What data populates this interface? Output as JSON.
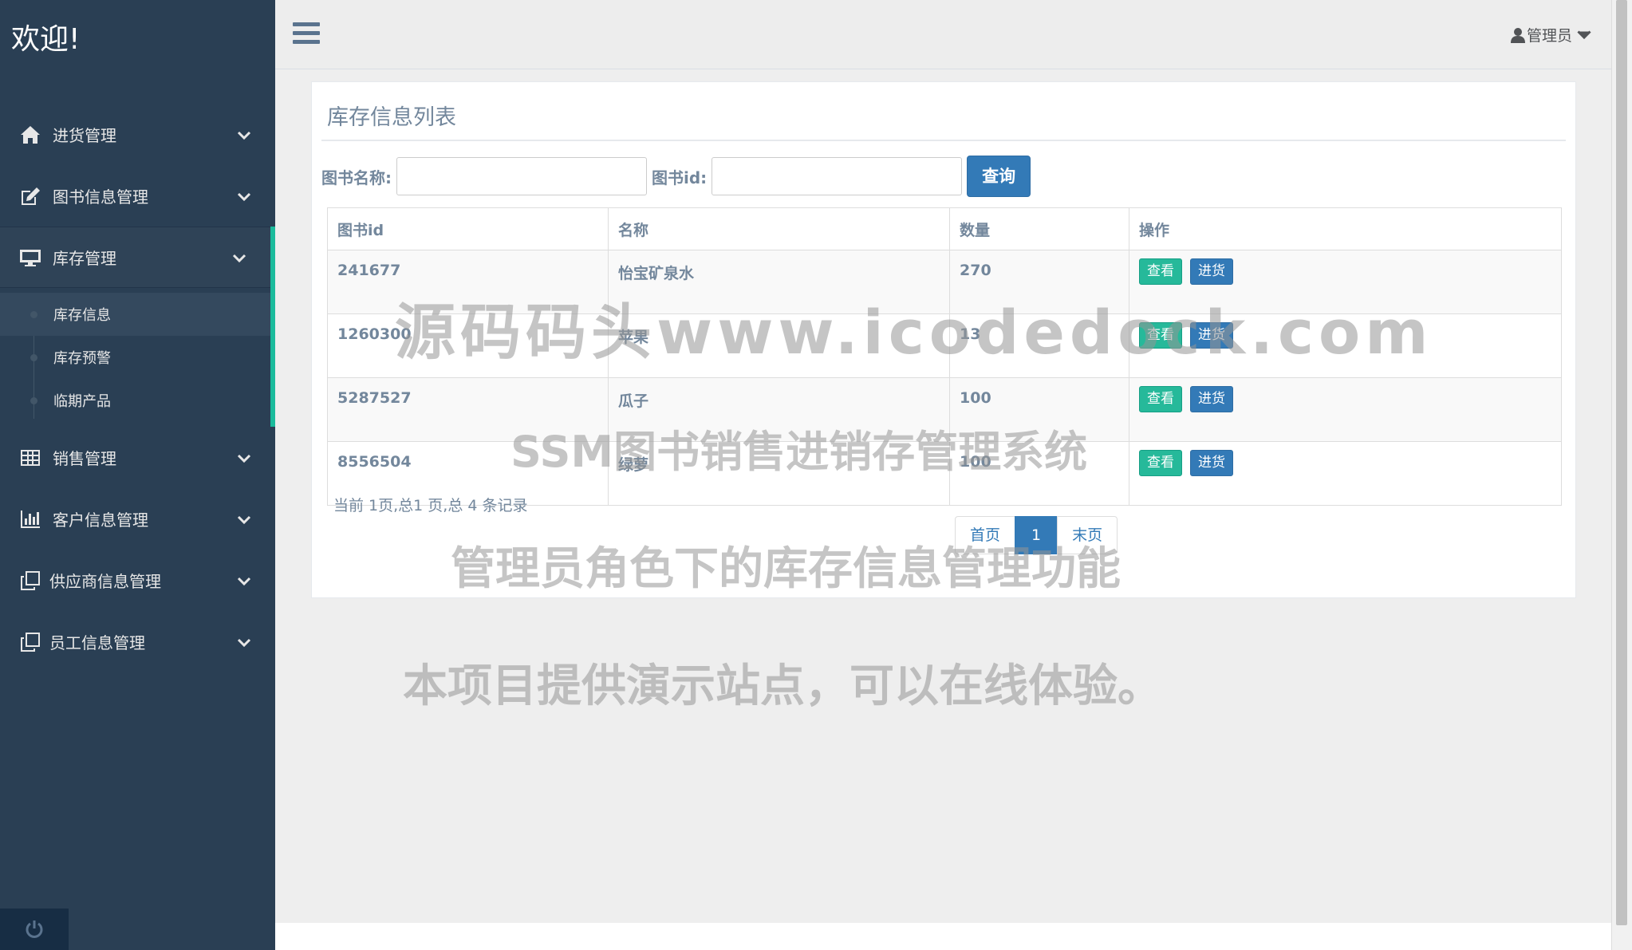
{
  "sidebar": {
    "brand": "欢迎!",
    "menu": [
      {
        "label": "进货管理",
        "icon": "home-icon"
      },
      {
        "label": "图书信息管理",
        "icon": "edit-icon"
      },
      {
        "label": "库存管理",
        "icon": "desktop-icon"
      },
      {
        "label": "销售管理",
        "icon": "table-icon"
      },
      {
        "label": "客户信息管理",
        "icon": "bar-chart-icon"
      },
      {
        "label": "供应商信息管理",
        "icon": "clone-icon"
      },
      {
        "label": "员工信息管理",
        "icon": "clone-icon"
      }
    ],
    "submenu": [
      "库存信息",
      "库存预警",
      "临期产品"
    ]
  },
  "topnav": {
    "user": "管理员"
  },
  "panel": {
    "title": "库存信息列表",
    "search": {
      "name_label": "图书名称:",
      "name_value": "",
      "id_label": "图书id:",
      "id_value": "",
      "button": "查询"
    },
    "table": {
      "headers": [
        "图书id",
        "名称",
        "数量",
        "操作"
      ],
      "rows": [
        {
          "id": "241677",
          "name": "怡宝矿泉水",
          "qty": "270"
        },
        {
          "id": "1260300",
          "name": "苹果",
          "qty": "13"
        },
        {
          "id": "5287527",
          "name": "瓜子",
          "qty": "100"
        },
        {
          "id": "8556504",
          "name": "绿萝",
          "qty": "100"
        }
      ],
      "view_label": "查看",
      "stock_label": "进货"
    },
    "page_info": "当前 1页,总1 页,总 4 条记录",
    "pagination": {
      "first": "首页",
      "current": "1",
      "last": "末页"
    }
  },
  "watermarks": [
    "源码码头www.icodedock.com",
    "SSM图书销售进销存管理系统",
    "管理员角色下的库存信息管理功能",
    "本项目提供演示站点，可以在线体验。"
  ],
  "colors": {
    "sidebar": "#2a3f54",
    "accent": "#1abb9c",
    "primary": "#337ab7",
    "success": "#26b99a"
  }
}
